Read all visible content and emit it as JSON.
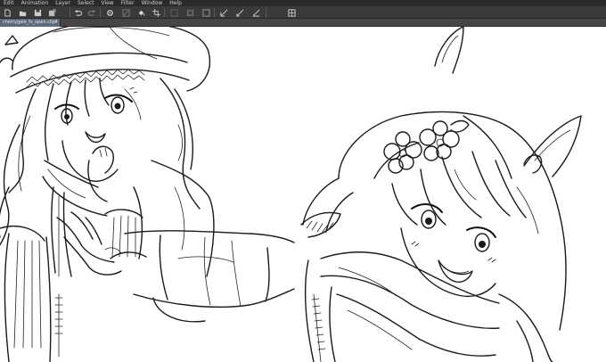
{
  "menubar": {
    "items": [
      "Edit",
      "Animation",
      "Layer",
      "Select",
      "View",
      "Filter",
      "Window",
      "Help"
    ]
  },
  "toolbar": {
    "tools": [
      {
        "icon": "new-canvas-icon"
      },
      {
        "icon": "open-icon"
      },
      {
        "icon": "save-icon"
      },
      {
        "icon": "save-dropdown-icon"
      },
      {
        "icon": "undo-icon"
      },
      {
        "icon": "redo-icon"
      },
      {
        "icon": "settings-icon"
      },
      {
        "icon": "clear-icon"
      },
      {
        "icon": "fill-icon"
      },
      {
        "icon": "crop-icon"
      },
      {
        "icon": "deselect-icon"
      },
      {
        "icon": "invert-selection-icon"
      },
      {
        "icon": "selection-border-icon"
      },
      {
        "icon": "ruler-icon"
      },
      {
        "icon": "snap-icon"
      },
      {
        "icon": "snap-special-ruler-icon"
      },
      {
        "icon": "snap-grid-icon"
      }
    ]
  },
  "document_tab": {
    "label": "cherrygale_fs_open.clip*",
    "close_glyph": "×"
  },
  "colors": {
    "menubar_bg": "#2b2b2b",
    "toolbar_bg": "#3a3a3a",
    "tab_active_bg": "#5e6a79",
    "canvas_bg": "#ffffff",
    "line_art": "#1a1a1a"
  }
}
